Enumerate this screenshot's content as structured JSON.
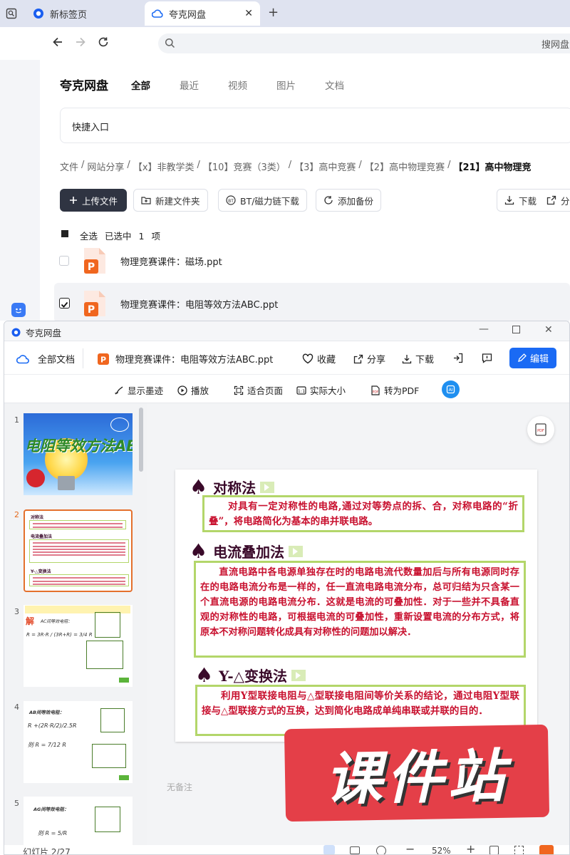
{
  "browser": {
    "tabs": [
      {
        "label": "新标签页"
      },
      {
        "label": "夸克网盘"
      }
    ],
    "address_text": "搜网盘"
  },
  "app": {
    "title": "夸克网盘",
    "nav": [
      "全部",
      "最近",
      "视频",
      "图片",
      "文档"
    ],
    "quick_entry": "快捷入口",
    "breadcrumb": [
      "文件",
      "网站分享",
      "【x】非教学类",
      "【10】竞赛（3类）",
      "【3】高中竞赛",
      "【2】高中物理竞赛",
      "【21】高中物理竞"
    ],
    "toolbar": {
      "upload": "上传文件",
      "new_folder": "新建文件夹",
      "bt": "BT/磁力链下载",
      "backup": "添加备份",
      "download": "下载",
      "share": "分"
    },
    "selection": {
      "select_all": "全选",
      "selected_prefix": "已选中",
      "count": "1",
      "unit": "项"
    },
    "files": [
      {
        "name": "物理竞赛课件：磁场.ppt",
        "checked": false
      },
      {
        "name": "物理竞赛课件：电阻等效方法ABC.ppt",
        "checked": true
      }
    ]
  },
  "viewer": {
    "window_title": "夸克网盘",
    "all_docs": "全部文档",
    "filename": "物理竞赛课件：电阻等效方法ABC.ppt",
    "actions": {
      "favorite": "收藏",
      "share": "分享",
      "download": "下载",
      "edit": "编辑"
    },
    "tools": {
      "ink": "显示墨迹",
      "play": "播放",
      "fit": "适合页面",
      "actual": "实际大小",
      "pdf": "转为PDF"
    },
    "thumbnail_numbers": [
      "1",
      "2",
      "3",
      "4",
      "5"
    ],
    "thumb1_title": "电阻等效方法ABC",
    "thumb2_lines": [
      "对称法",
      "电流叠加法",
      "Y-△变换法"
    ],
    "thumb3_lines": [
      "解",
      "AC间等效电阻："
    ],
    "thumb4_lines": [
      "AB间等效电阻："
    ],
    "thumb5_lines": [
      "AG间等效电阻：",
      "则 R = 5/R"
    ],
    "slide": {
      "sections": [
        {
          "heading": "对称法",
          "body": "对具有一定对称性的电路,通过对等势点的拆、合，对称电路的“折叠”，将电路简化为基本的串并联电路。"
        },
        {
          "heading": "电流叠加法",
          "body": "直流电路中各电源单独存在时的电路电流代数量加后与所有电源同时存在的电路电流分布是一样的，任一直流电路电流分布，总可归结为只含某一个直流电源的电路电流分布．这就是电流的可叠加性．对于一些并不具备直观的对称性的电路，可根据电流的可叠加性，重新设置电流的分布方式，将原本不对称问题转化成具有对称性的问题加以解决．"
        },
        {
          "heading": "Y-△变换法",
          "body": "利用Y型联接电阻与△型联接电阻间等价关系的结论，通过电阻Y型联接与△型联接方式的互换，达到简化电路成单纯串联或并联的目的．"
        }
      ]
    },
    "notes": "无备注",
    "status": {
      "slide_label": "幻灯片 2/27",
      "zoom": "52%"
    }
  },
  "watermark": "课件站",
  "colors": {
    "accent": "#1a6af4",
    "dark_button": "#2f3442",
    "slide_text": "#c8102e",
    "slide_border": "#b3d66a"
  }
}
